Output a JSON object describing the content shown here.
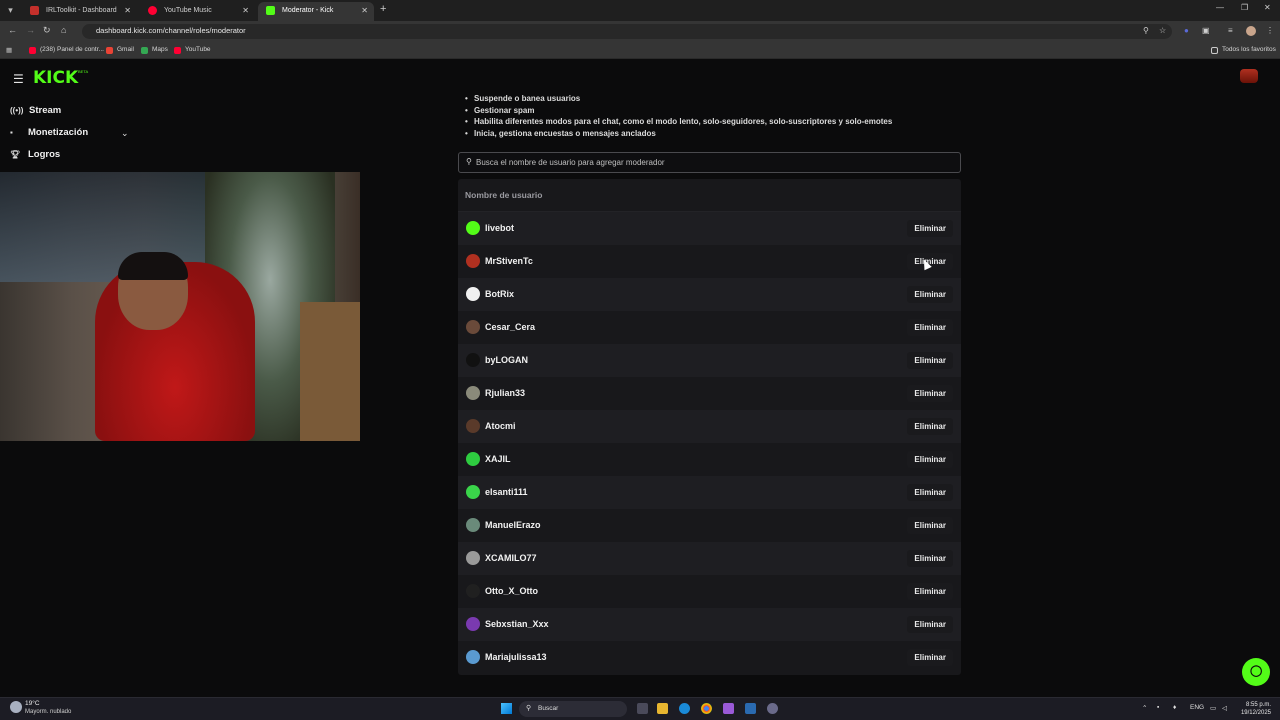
{
  "browser": {
    "tabs": [
      {
        "label": "IRLToolkit - Dashboard",
        "favicon_color": "#c4302b",
        "active": false
      },
      {
        "label": "YouTube Music",
        "favicon_color": "#ff0033",
        "active": false
      },
      {
        "label": "Moderator - Kick Dashboard",
        "favicon_color": "#53fc18",
        "active": true
      }
    ],
    "url": "dashboard.kick.com/channel/roles/moderator",
    "bookmarks": [
      {
        "label": "(238) Panel de contr...",
        "color": "#ff0033"
      },
      {
        "label": "Gmail",
        "color": "#ea4335"
      },
      {
        "label": "Maps",
        "color": "#34a853"
      },
      {
        "label": "YouTube",
        "color": "#ff0033"
      }
    ],
    "all_bookmarks_label": "Todos los favoritos"
  },
  "header": {
    "logo": "KICK",
    "logo_badge": "BETA"
  },
  "sidebar": {
    "items": [
      {
        "label": "Stream",
        "icon": "broadcast-icon"
      },
      {
        "label": "Monetización",
        "icon": "wallet-icon"
      },
      {
        "label": "Logros",
        "icon": "trophy-icon"
      }
    ]
  },
  "permissions": [
    "Suspende o banea usuarios",
    "Gestionar spam",
    "Habilita diferentes modos para el chat, como el modo lento, solo-seguidores, solo-suscriptores y solo-emotes",
    "Inicia, gestiona encuestas o mensajes anclados"
  ],
  "search": {
    "placeholder": "Busca el nombre de usuario para agregar moderador",
    "value": ""
  },
  "table": {
    "header": "Nombre de usuario",
    "remove_label": "Eliminar",
    "rows": [
      {
        "username": "livebot",
        "avatar_color": "#53fc18"
      },
      {
        "username": "MrStivenTc",
        "avatar_color": "#b03020"
      },
      {
        "username": "BotRix",
        "avatar_color": "#f0f0f0"
      },
      {
        "username": "Cesar_Cera",
        "avatar_color": "#6a4a3a"
      },
      {
        "username": "byLOGAN",
        "avatar_color": "#111111"
      },
      {
        "username": "Rjulian33",
        "avatar_color": "#8a8a7a"
      },
      {
        "username": "Atocmi",
        "avatar_color": "#5a3a2a"
      },
      {
        "username": "XAJIL",
        "avatar_color": "#2ecc40"
      },
      {
        "username": "elsanti111",
        "avatar_color": "#3ad44a"
      },
      {
        "username": "ManuelErazo",
        "avatar_color": "#6a8a7a"
      },
      {
        "username": "XCAMILO77",
        "avatar_color": "#9a9a9a"
      },
      {
        "username": "Otto_X_Otto",
        "avatar_color": "#202020"
      },
      {
        "username": "Sebxstian_Xxx",
        "avatar_color": "#7a3ab0"
      },
      {
        "username": "Mariajulissa13",
        "avatar_color": "#5a9ad0"
      }
    ]
  },
  "taskbar": {
    "temperature": "19°C",
    "weather": "Mayorm. nublado",
    "search_label": "Buscar",
    "language": "ENG",
    "time": "8:55 p.m.",
    "date": "19/12/2025"
  }
}
